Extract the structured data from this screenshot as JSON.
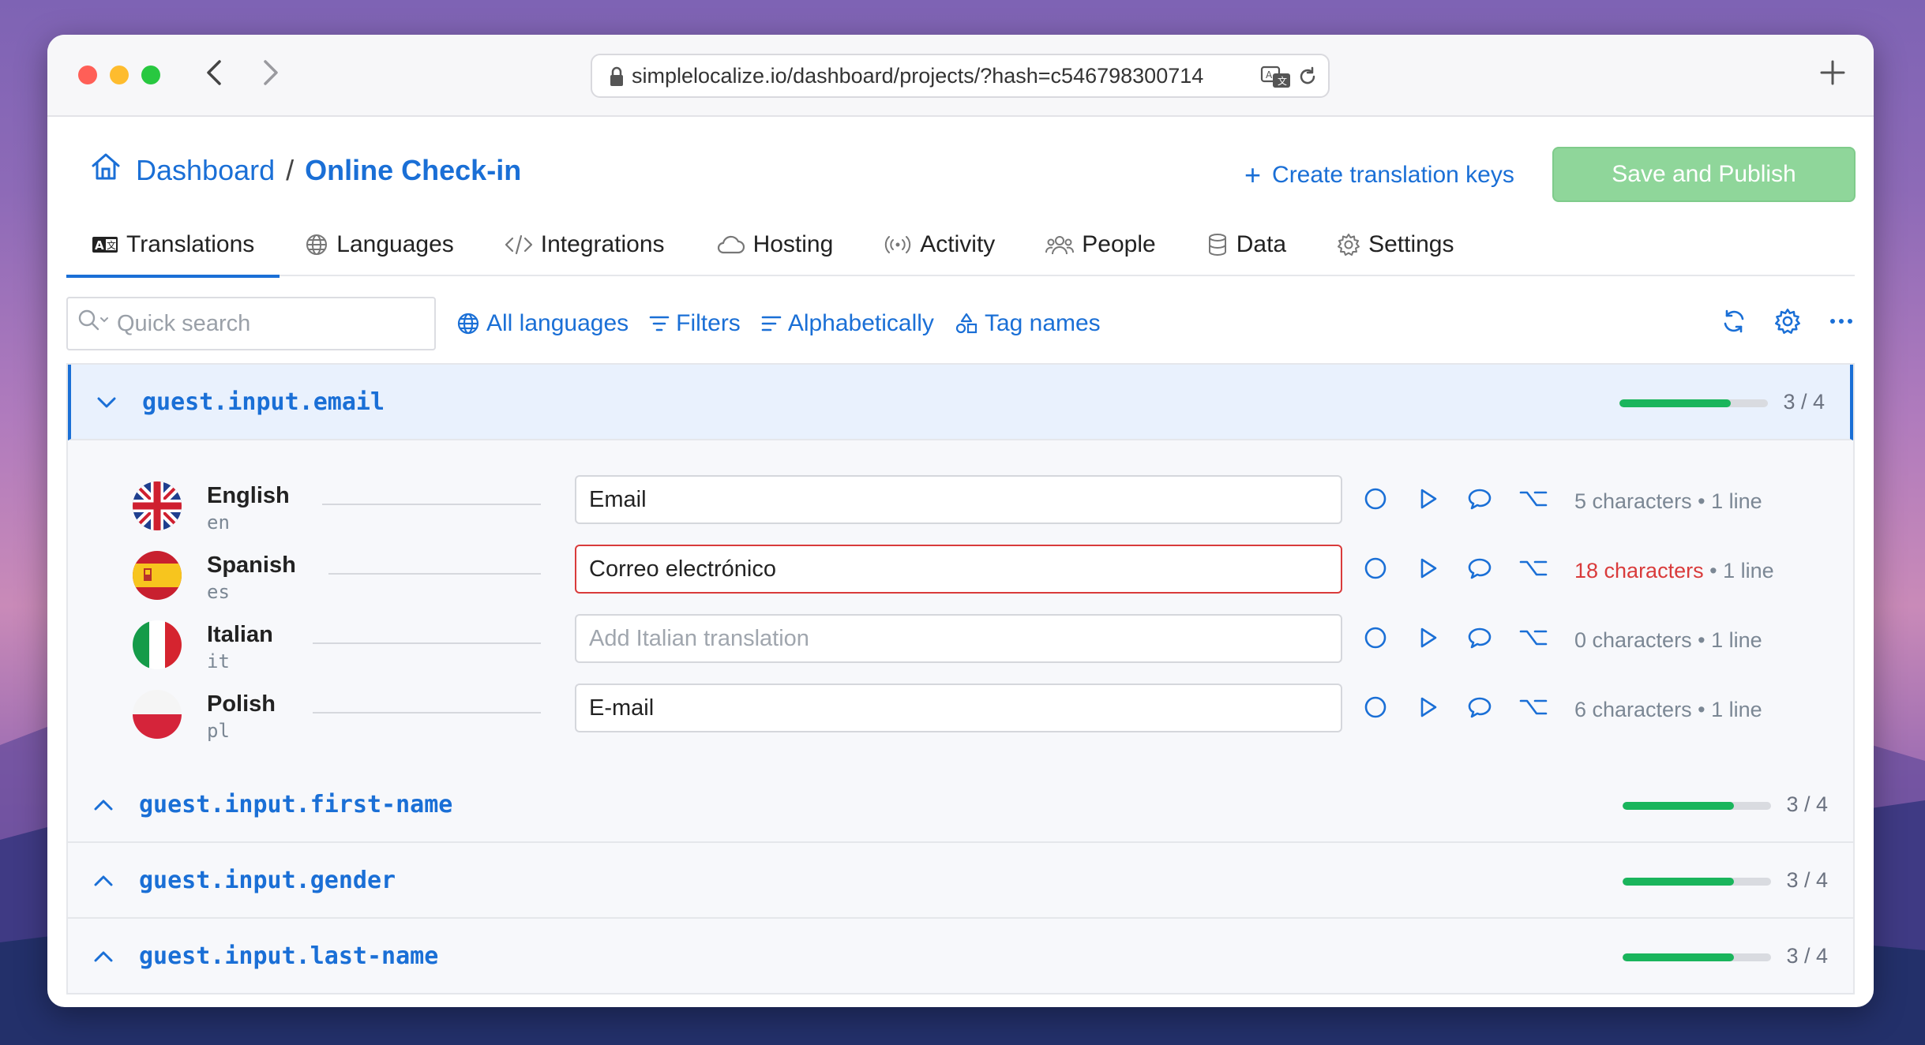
{
  "browser": {
    "url": "simplelocalize.io/dashboard/projects/?hash=c546798300714"
  },
  "header": {
    "breadcrumb_root": "Dashboard",
    "breadcrumb_sep": "/",
    "breadcrumb_current": "Online Check-in",
    "create_keys_label": "Create translation keys",
    "save_label": "Save and Publish"
  },
  "tabs": [
    {
      "label": "Translations",
      "icon": "translation-icon",
      "active": true
    },
    {
      "label": "Languages",
      "icon": "globe-icon"
    },
    {
      "label": "Integrations",
      "icon": "code-icon"
    },
    {
      "label": "Hosting",
      "icon": "cloud-icon"
    },
    {
      "label": "Activity",
      "icon": "broadcast-icon"
    },
    {
      "label": "People",
      "icon": "people-icon"
    },
    {
      "label": "Data",
      "icon": "database-icon"
    },
    {
      "label": "Settings",
      "icon": "gear-icon"
    }
  ],
  "toolbar": {
    "search_placeholder": "Quick search",
    "all_languages": "All languages",
    "filters": "Filters",
    "sort": "Alphabetically",
    "tag_names": "Tag names"
  },
  "keys": [
    {
      "name": "guest.input.email",
      "progress": 0.75,
      "count": "3 / 4",
      "expanded": true,
      "translations": [
        {
          "lang": "English",
          "code": "en",
          "value": "Email",
          "placeholder": "",
          "chars": "5 characters",
          "lines": "1 line",
          "error": false
        },
        {
          "lang": "Spanish",
          "code": "es",
          "value": "Correo electrónico",
          "placeholder": "",
          "chars": "18 characters",
          "lines": "1 line",
          "error": true
        },
        {
          "lang": "Italian",
          "code": "it",
          "value": "",
          "placeholder": "Add Italian translation",
          "chars": "0 characters",
          "lines": "1 line",
          "error": false
        },
        {
          "lang": "Polish",
          "code": "pl",
          "value": "E-mail",
          "placeholder": "",
          "chars": "6 characters",
          "lines": "1 line",
          "error": false
        }
      ]
    },
    {
      "name": "guest.input.first-name",
      "progress": 0.75,
      "count": "3 / 4"
    },
    {
      "name": "guest.input.gender",
      "progress": 0.75,
      "count": "3 / 4"
    },
    {
      "name": "guest.input.last-name",
      "progress": 0.75,
      "count": "3 / 4"
    }
  ],
  "meta_separator": "•",
  "colors": {
    "accent": "#1a6fd6",
    "progress": "#1ab55c",
    "error": "#d93b3b",
    "save_button": "#8fd69a"
  }
}
